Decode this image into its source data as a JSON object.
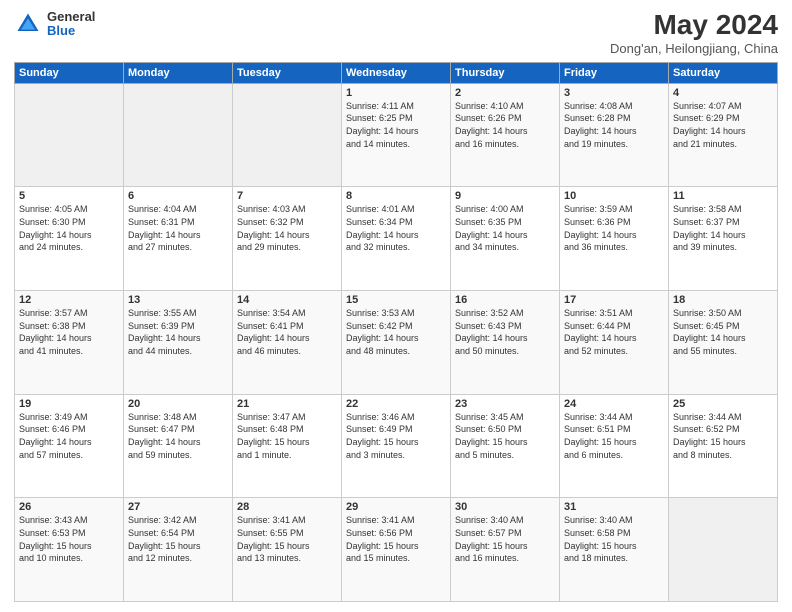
{
  "logo": {
    "general": "General",
    "blue": "Blue"
  },
  "header": {
    "title": "May 2024",
    "subtitle": "Dong'an, Heilongjiang, China"
  },
  "weekdays": [
    "Sunday",
    "Monday",
    "Tuesday",
    "Wednesday",
    "Thursday",
    "Friday",
    "Saturday"
  ],
  "weeks": [
    [
      {
        "day": "",
        "info": ""
      },
      {
        "day": "",
        "info": ""
      },
      {
        "day": "",
        "info": ""
      },
      {
        "day": "1",
        "info": "Sunrise: 4:11 AM\nSunset: 6:25 PM\nDaylight: 14 hours\nand 14 minutes."
      },
      {
        "day": "2",
        "info": "Sunrise: 4:10 AM\nSunset: 6:26 PM\nDaylight: 14 hours\nand 16 minutes."
      },
      {
        "day": "3",
        "info": "Sunrise: 4:08 AM\nSunset: 6:28 PM\nDaylight: 14 hours\nand 19 minutes."
      },
      {
        "day": "4",
        "info": "Sunrise: 4:07 AM\nSunset: 6:29 PM\nDaylight: 14 hours\nand 21 minutes."
      }
    ],
    [
      {
        "day": "5",
        "info": "Sunrise: 4:05 AM\nSunset: 6:30 PM\nDaylight: 14 hours\nand 24 minutes."
      },
      {
        "day": "6",
        "info": "Sunrise: 4:04 AM\nSunset: 6:31 PM\nDaylight: 14 hours\nand 27 minutes."
      },
      {
        "day": "7",
        "info": "Sunrise: 4:03 AM\nSunset: 6:32 PM\nDaylight: 14 hours\nand 29 minutes."
      },
      {
        "day": "8",
        "info": "Sunrise: 4:01 AM\nSunset: 6:34 PM\nDaylight: 14 hours\nand 32 minutes."
      },
      {
        "day": "9",
        "info": "Sunrise: 4:00 AM\nSunset: 6:35 PM\nDaylight: 14 hours\nand 34 minutes."
      },
      {
        "day": "10",
        "info": "Sunrise: 3:59 AM\nSunset: 6:36 PM\nDaylight: 14 hours\nand 36 minutes."
      },
      {
        "day": "11",
        "info": "Sunrise: 3:58 AM\nSunset: 6:37 PM\nDaylight: 14 hours\nand 39 minutes."
      }
    ],
    [
      {
        "day": "12",
        "info": "Sunrise: 3:57 AM\nSunset: 6:38 PM\nDaylight: 14 hours\nand 41 minutes."
      },
      {
        "day": "13",
        "info": "Sunrise: 3:55 AM\nSunset: 6:39 PM\nDaylight: 14 hours\nand 44 minutes."
      },
      {
        "day": "14",
        "info": "Sunrise: 3:54 AM\nSunset: 6:41 PM\nDaylight: 14 hours\nand 46 minutes."
      },
      {
        "day": "15",
        "info": "Sunrise: 3:53 AM\nSunset: 6:42 PM\nDaylight: 14 hours\nand 48 minutes."
      },
      {
        "day": "16",
        "info": "Sunrise: 3:52 AM\nSunset: 6:43 PM\nDaylight: 14 hours\nand 50 minutes."
      },
      {
        "day": "17",
        "info": "Sunrise: 3:51 AM\nSunset: 6:44 PM\nDaylight: 14 hours\nand 52 minutes."
      },
      {
        "day": "18",
        "info": "Sunrise: 3:50 AM\nSunset: 6:45 PM\nDaylight: 14 hours\nand 55 minutes."
      }
    ],
    [
      {
        "day": "19",
        "info": "Sunrise: 3:49 AM\nSunset: 6:46 PM\nDaylight: 14 hours\nand 57 minutes."
      },
      {
        "day": "20",
        "info": "Sunrise: 3:48 AM\nSunset: 6:47 PM\nDaylight: 14 hours\nand 59 minutes."
      },
      {
        "day": "21",
        "info": "Sunrise: 3:47 AM\nSunset: 6:48 PM\nDaylight: 15 hours\nand 1 minute."
      },
      {
        "day": "22",
        "info": "Sunrise: 3:46 AM\nSunset: 6:49 PM\nDaylight: 15 hours\nand 3 minutes."
      },
      {
        "day": "23",
        "info": "Sunrise: 3:45 AM\nSunset: 6:50 PM\nDaylight: 15 hours\nand 5 minutes."
      },
      {
        "day": "24",
        "info": "Sunrise: 3:44 AM\nSunset: 6:51 PM\nDaylight: 15 hours\nand 6 minutes."
      },
      {
        "day": "25",
        "info": "Sunrise: 3:44 AM\nSunset: 6:52 PM\nDaylight: 15 hours\nand 8 minutes."
      }
    ],
    [
      {
        "day": "26",
        "info": "Sunrise: 3:43 AM\nSunset: 6:53 PM\nDaylight: 15 hours\nand 10 minutes."
      },
      {
        "day": "27",
        "info": "Sunrise: 3:42 AM\nSunset: 6:54 PM\nDaylight: 15 hours\nand 12 minutes."
      },
      {
        "day": "28",
        "info": "Sunrise: 3:41 AM\nSunset: 6:55 PM\nDaylight: 15 hours\nand 13 minutes."
      },
      {
        "day": "29",
        "info": "Sunrise: 3:41 AM\nSunset: 6:56 PM\nDaylight: 15 hours\nand 15 minutes."
      },
      {
        "day": "30",
        "info": "Sunrise: 3:40 AM\nSunset: 6:57 PM\nDaylight: 15 hours\nand 16 minutes."
      },
      {
        "day": "31",
        "info": "Sunrise: 3:40 AM\nSunset: 6:58 PM\nDaylight: 15 hours\nand 18 minutes."
      },
      {
        "day": "",
        "info": ""
      }
    ]
  ]
}
